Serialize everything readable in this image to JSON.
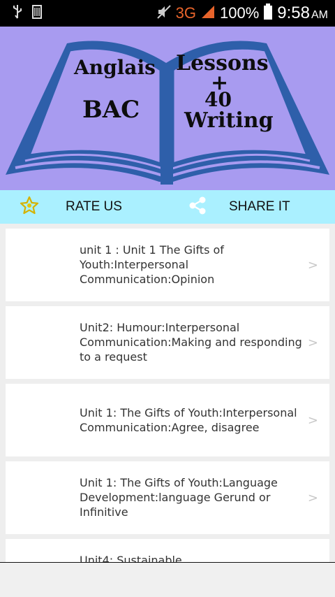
{
  "status_bar": {
    "network": "3G",
    "battery": "100%",
    "time": "9:58",
    "ampm": "AM"
  },
  "banner": {
    "left_word1": "Anglais",
    "left_word2": "BAC",
    "right_word1": "Lessons",
    "plus": "+",
    "number": "40",
    "right_word2": "Writing"
  },
  "actions": {
    "rate_label": "RATE US",
    "share_label": "SHARE IT"
  },
  "lessons": [
    {
      "text": "unit 1 : Unit 1 The Gifts of Youth:Interpersonal Communication:Opinion"
    },
    {
      "text": "Unit2: Humour:Interpersonal Communication:Making and responding to a request"
    },
    {
      "text": "Unit 1: The Gifts of Youth:Interpersonal Communication:Agree, disagree"
    },
    {
      "text": "Unit 1: The Gifts of Youth:Language Development:language Gerund or Infinitive"
    },
    {
      "text": "Unit4: Sustainable"
    }
  ],
  "chevron": ">"
}
